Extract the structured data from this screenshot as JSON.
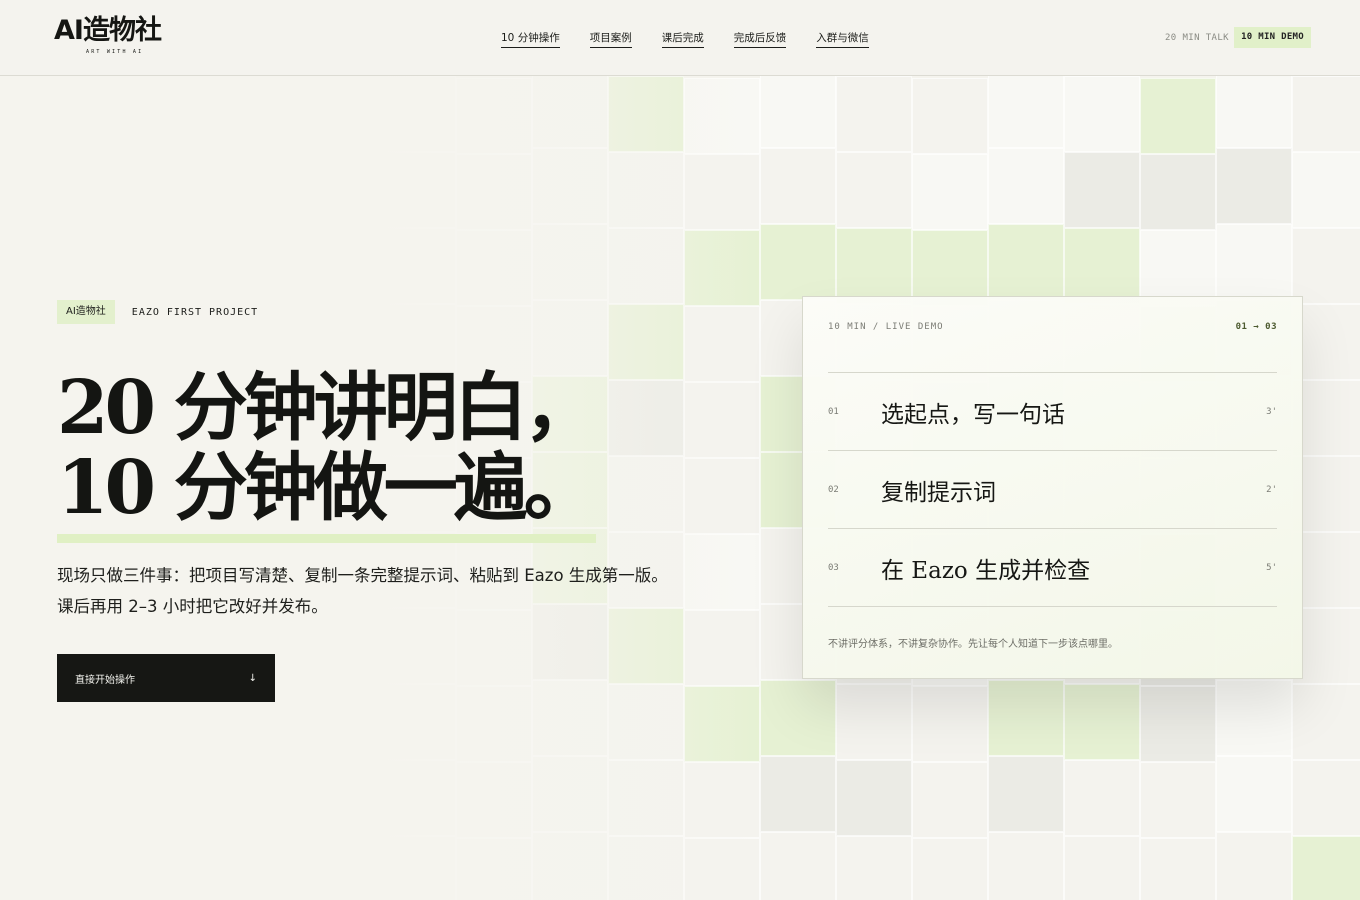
{
  "header": {
    "logo_text": "AI造物社",
    "logo_sub": "ART WITH AI",
    "nav": [
      {
        "label": "10 分钟操作"
      },
      {
        "label": "项目案例"
      },
      {
        "label": "课后完成"
      },
      {
        "label": "完成后反馈"
      },
      {
        "label": "入群与微信"
      }
    ],
    "talk": "20 MIN TALK",
    "demo": "10 MIN DEMO"
  },
  "hero": {
    "badge": "AI造物社",
    "kicker": "EAZO FIRST PROJECT",
    "title_line1": "20 分钟讲明白，",
    "title_line2": "10 分钟做一遍。",
    "desc_line1": "现场只做三件事：把项目写清楚、复制一条完整提示词、粘贴到 Eazo 生成第一版。",
    "desc_line2": "课后再用 2–3 小时把它改好并发布。",
    "cta_label": "直接开始操作",
    "cta_arrow": "↓"
  },
  "card": {
    "label": "10 MIN / LIVE DEMO",
    "steps": "01 → 03",
    "rows": [
      {
        "num": "01",
        "title": "选起点，写一句话",
        "time": "3'"
      },
      {
        "num": "02",
        "title": "复制提示词",
        "time": "2'"
      },
      {
        "num": "03",
        "title": "在 Eazo 生成并检查",
        "time": "5'"
      }
    ],
    "note": "不讲评分体系，不讲复杂协作。先让每个人知道下一步该点哪里。"
  },
  "colors": {
    "accent_green": "#e1f0c9",
    "ink": "#161714",
    "paper": "#f5f4ee"
  }
}
